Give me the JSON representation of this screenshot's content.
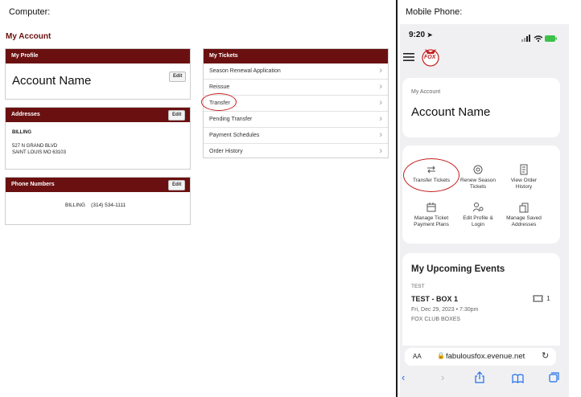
{
  "captions": {
    "computer": "Computer:",
    "mobile": "Mobile Phone:"
  },
  "desktop": {
    "page_title": "My Account",
    "profile": {
      "header": "My Profile",
      "edit": "Edit",
      "account_name": "Account Name"
    },
    "addresses": {
      "header": "Addresses",
      "edit": "Edit",
      "type": "BILLING",
      "line1": "527 N GRAND BLVD",
      "line2": "SAINT LOUIS MO 63103"
    },
    "phones": {
      "header": "Phone Numbers",
      "edit": "Edit",
      "type": "BILLING",
      "number": "(314) 534-1111"
    },
    "tickets": {
      "header": "My Tickets",
      "items": [
        "Season Renewal Application",
        "Reissue",
        "Transfer",
        "Pending Transfer",
        "Payment Schedules",
        "Order History"
      ],
      "highlighted": "Transfer"
    }
  },
  "mobile": {
    "time": "9:20",
    "logo_text": "FOX",
    "account_label": "My Account",
    "account_name": "Account Name",
    "actions": [
      {
        "label1": "Transfer Tickets",
        "label2": "",
        "icon": "transfer-icon"
      },
      {
        "label1": "Renew Season",
        "label2": "Tickets",
        "icon": "renew-icon"
      },
      {
        "label1": "View Order",
        "label2": "History",
        "icon": "order-history-icon"
      },
      {
        "label1": "Manage Ticket",
        "label2": "Payment Plans",
        "icon": "calendar-icon"
      },
      {
        "label1": "Edit Profile &",
        "label2": "Login",
        "icon": "profile-settings-icon"
      },
      {
        "label1": "Manage Saved",
        "label2": "Addresses",
        "icon": "address-icon"
      }
    ],
    "events": {
      "heading": "My Upcoming Events",
      "category": "TEST",
      "title": "TEST - BOX 1",
      "date": "Fri, Dec 29, 2023 • 7:30pm",
      "venue": "FOX CLUB BOXES",
      "ticket_count": "1"
    },
    "browser": {
      "text_size": "AA",
      "url": "fabulousfox.evenue.net"
    }
  },
  "colors": {
    "brand": "#6b1010",
    "highlight": "#c41d1d",
    "ios_blue": "#1f6fe8"
  }
}
